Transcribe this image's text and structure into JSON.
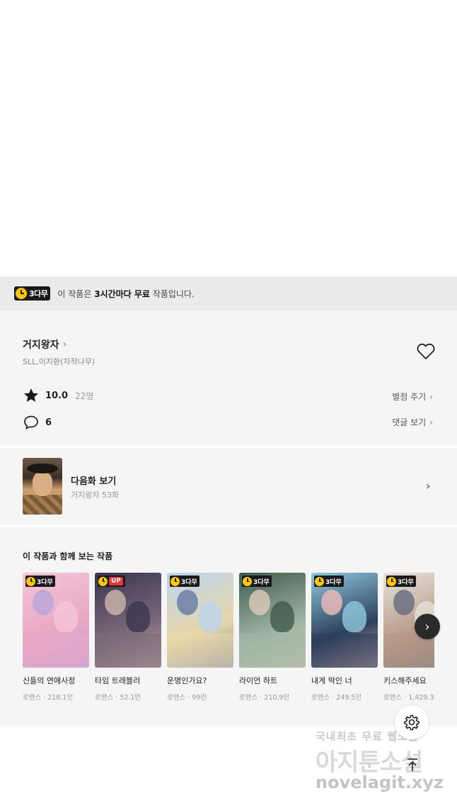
{
  "banner": {
    "badge": "3다무",
    "message_prefix": "이 작품은 ",
    "message_bold": "3시간마다 무료",
    "message_suffix": " 작품입니다."
  },
  "work": {
    "title": "거지왕자",
    "author": "SLL,이지환(자작나무)",
    "rating": "10.0",
    "rating_count": "22명",
    "rate_action": "별점 주기",
    "comment_count": "6",
    "comment_action": "댓글 보기"
  },
  "next_episode": {
    "label": "다음화 보기",
    "subtitle": "거지왕자 53화"
  },
  "recommendations": {
    "heading": "이 작품과 함께 보는 작품",
    "items": [
      {
        "title": "신들의 연애사정",
        "meta": "로맨스 · 218.1만",
        "tag": "3다무",
        "colors": [
          "#f4c6d8",
          "#e9a6c4",
          "#b9a7d8"
        ]
      },
      {
        "title": "타임 트래블러",
        "meta": "로맨스 · 52.1만",
        "tag": "UP",
        "colors": [
          "#3b3550",
          "#7a6a7a",
          "#c9b2a6"
        ]
      },
      {
        "title": "운명인가요?",
        "meta": "로맨스 · 99만",
        "tag": "3다무",
        "colors": [
          "#bcd4ee",
          "#e8d7a8",
          "#6f7fa8"
        ]
      },
      {
        "title": "라이언 하트",
        "meta": "로맨스 · 210.9만",
        "tag": "3다무",
        "colors": [
          "#3d5a4e",
          "#9fb5a3",
          "#d8c8b8"
        ]
      },
      {
        "title": "내게 딱인 너",
        "meta": "로맨스 · 249.5만",
        "tag": "3다무",
        "colors": [
          "#8ec9e0",
          "#2d3f5a",
          "#e8b8b8"
        ]
      },
      {
        "title": "키스해주세요",
        "meta": "로맨스 · 1,429.3",
        "tag": "3다무",
        "colors": [
          "#e6e2dc",
          "#b89a86",
          "#6a7080"
        ]
      }
    ]
  },
  "watermark": {
    "line1": "국내최초 무료 웹소설",
    "line2": "아지툰소설",
    "line3": "novelagit.xyz"
  },
  "icons": {
    "clock": "clock-icon",
    "heart": "heart-icon",
    "star": "star-icon",
    "comment": "comment-icon",
    "chevron": "chevron-right-icon",
    "settings": "gear-icon",
    "top": "arrow-up-icon"
  },
  "colors": {
    "badge_yellow": "#ffc700",
    "up_red": "#e8333d",
    "panel_bg": "#f5f5f5",
    "banner_bg": "#ebebeb"
  }
}
